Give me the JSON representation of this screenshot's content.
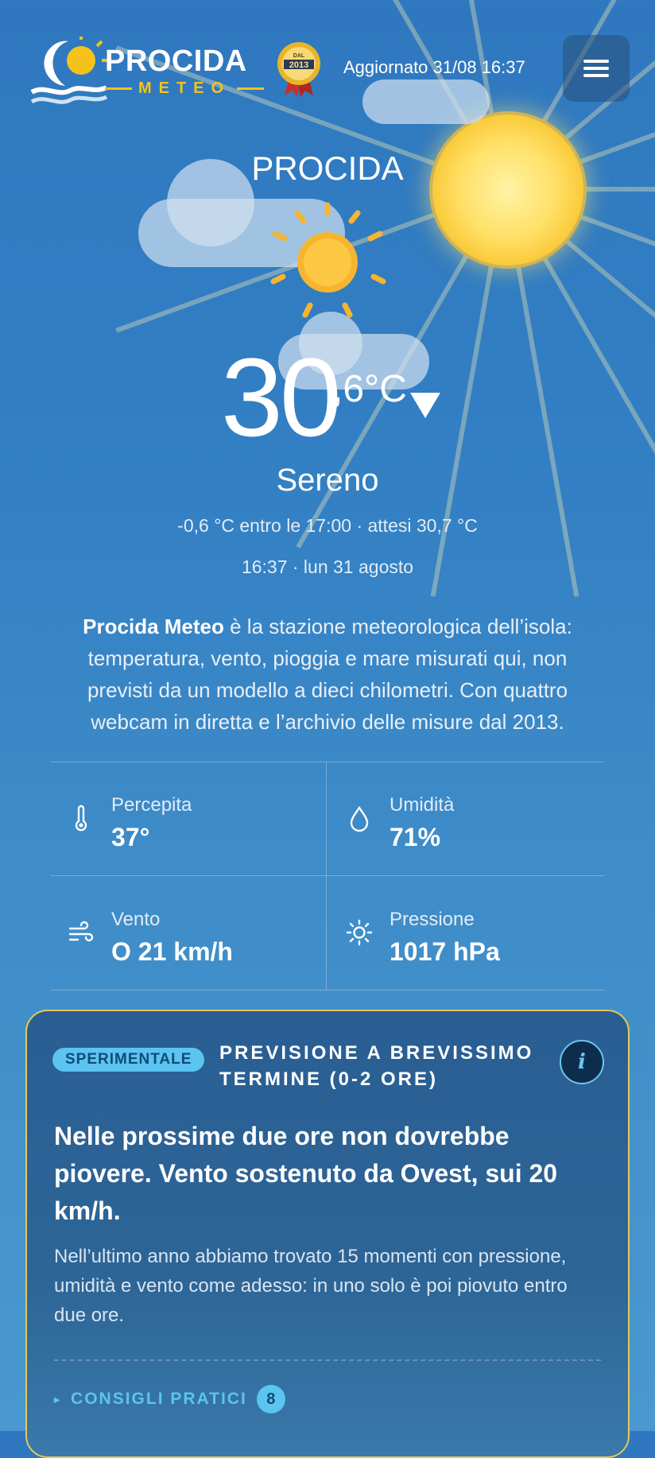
{
  "header": {
    "logo_name": "PROCIDA",
    "logo_sub": "METEO",
    "badge_top": "DAL",
    "badge_year": "2013",
    "updated": "Aggiornato 31/08 16:37"
  },
  "current": {
    "city": "PROCIDA",
    "temp_int": "30",
    "temp_dec": ",6°C",
    "condition": "Sereno",
    "trend": "-0,6 °C entro le 17:00 · attesi 30,7 °C",
    "datetime": "16:37 · lun 31 agosto"
  },
  "intro": {
    "brand": "Procida Meteo",
    "text": " è la stazione meteorologica dell’isola: temperatura, vento, pioggia e mare misurati qui, non previsti da un modello a dieci chilometri. Con quattro webcam in diretta e l’archivio delle misure dal 2013."
  },
  "stats": {
    "feels": {
      "label": "Percepita",
      "value": "37°"
    },
    "humidity": {
      "label": "Umidità",
      "value": "71%"
    },
    "wind": {
      "label": "Vento",
      "value": "O 21 km/h"
    },
    "pressure": {
      "label": "Pressione",
      "value": "1017 hPa"
    }
  },
  "nowcast": {
    "tag": "SPERIMENTALE",
    "title": "PREVISIONE A BREVISSIMO TERMINE (0-2 ORE)",
    "info": "i",
    "headline": "Nelle prossime due ore non dovrebbe piovere. Vento sostenuto da Ovest, sui 20 km/h.",
    "detail": "Nell’ultimo anno abbiamo trovato 15 momenti con pressione, umidità e vento come adesso: in uno solo è poi piovuto entro due ore.",
    "tips_label": "CONSIGLI PRATICI",
    "tips_count": "8"
  },
  "colors": {
    "accent": "#5bc4f0",
    "sun": "#f9c632",
    "card_border": "#e4c85a"
  },
  "icons": [
    "logo-icon",
    "award-badge-icon",
    "menu-icon",
    "sun-icon",
    "cloud-icon",
    "thermometer-icon",
    "droplet-icon",
    "wind-icon",
    "pressure-sun-icon",
    "info-icon",
    "triangle-right-icon"
  ]
}
